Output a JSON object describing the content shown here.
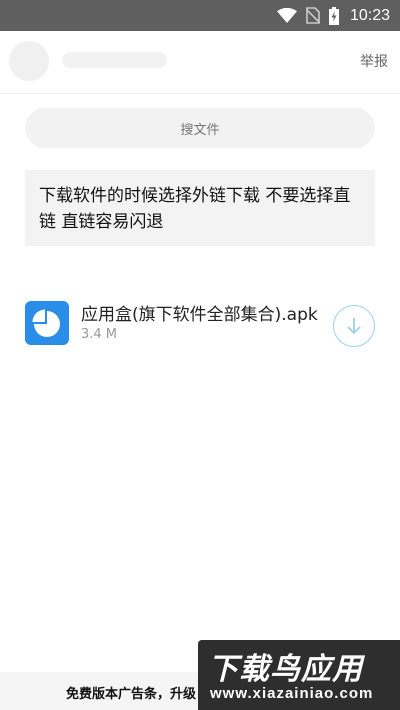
{
  "status_bar": {
    "time": "10:23",
    "icons": [
      "wifi-icon",
      "no-sim-icon",
      "battery-charging-icon"
    ]
  },
  "header": {
    "report_label": "举报"
  },
  "search": {
    "label": "搜文件"
  },
  "notice": {
    "text": "下载软件的时候选择外链下载 不要选择直链 直链容易闪退"
  },
  "file": {
    "name": "应用盒(旗下软件全部集合).apk",
    "size": "3.4 M",
    "icon": "pie-chart-app-icon",
    "action_icon": "download-arrow-icon"
  },
  "ad_bar": {
    "text": "免费版本广告条，升级"
  },
  "watermark": {
    "title": "下载鸟应用",
    "url": "www.xiazainiao.com"
  },
  "colors": {
    "status_bar": "#5f5f5f",
    "file_icon": "#2a8ee8",
    "download_ring": "#9fd0ee",
    "watermark_bg": "#2e2e2e"
  }
}
